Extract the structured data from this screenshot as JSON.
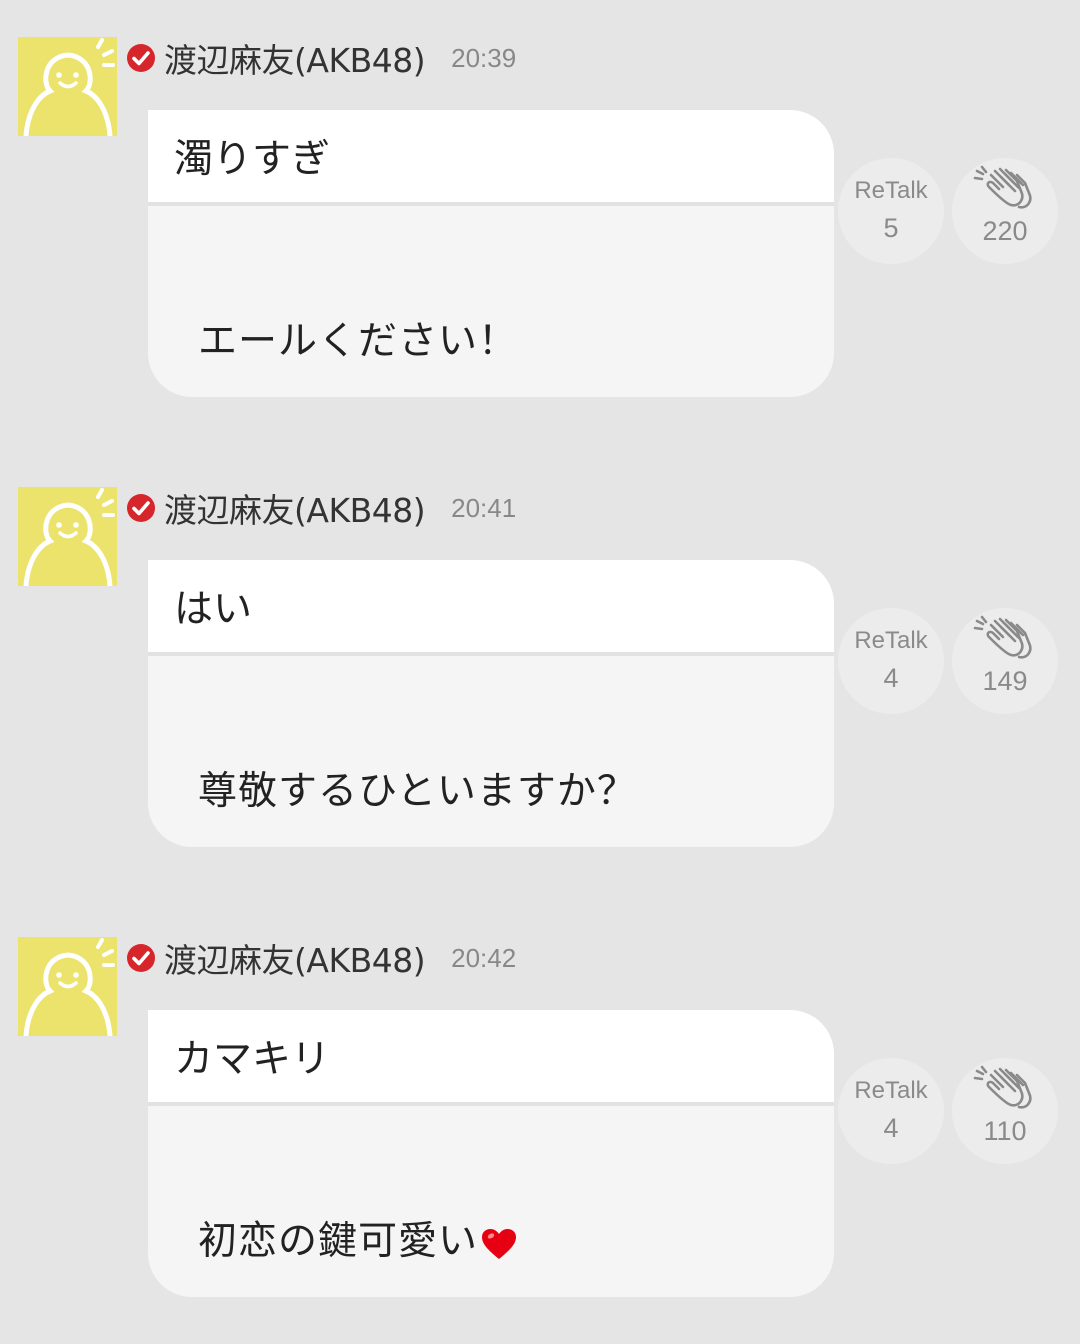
{
  "posts": [
    {
      "author": "渡辺麻友(AKB48)",
      "time": "20:39",
      "reply_to": "濁りすぎ",
      "message": "エールください！",
      "has_heart": false,
      "retalk_label": "ReTalk",
      "retalk_count": "5",
      "clap_count": "220"
    },
    {
      "author": "渡辺麻友(AKB48)",
      "time": "20:41",
      "reply_to": "はい",
      "message": "尊敬するひといますか？",
      "has_heart": false,
      "retalk_label": "ReTalk",
      "retalk_count": "4",
      "clap_count": "149"
    },
    {
      "author": "渡辺麻友(AKB48)",
      "time": "20:42",
      "reply_to": "カマキリ",
      "message": "初恋の鍵可愛い",
      "has_heart": true,
      "retalk_label": "ReTalk",
      "retalk_count": "4",
      "clap_count": "110"
    }
  ],
  "icons": {
    "avatar": "smiling-figure-avatar-icon",
    "verified": "verified-check-icon",
    "clap": "clapping-hands-icon",
    "heart": "heart-icon"
  },
  "colors": {
    "background": "#e5e5e5",
    "avatar_bg": "#ece36d",
    "verified_red": "#d7262b",
    "heart_red": "#e60012",
    "bubble": "#f5f5f5",
    "reply_bg": "#ffffff",
    "muted_text": "#888888"
  }
}
